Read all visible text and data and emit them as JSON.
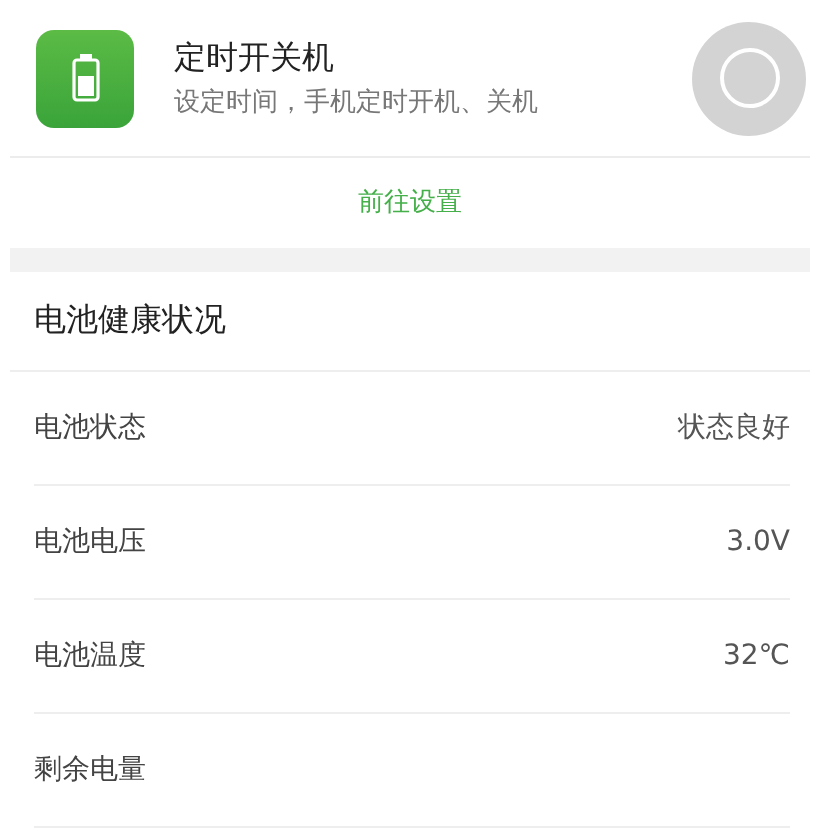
{
  "feature": {
    "title": "定时开关机",
    "subtitle": "设定时间，手机定时开机、关机",
    "toggle": {
      "on": false
    }
  },
  "link": "前往设置",
  "section": {
    "title": "电池健康状况",
    "rows": [
      {
        "label": "电池状态",
        "value": "状态良好"
      },
      {
        "label": "电池电压",
        "value": "3.0V"
      },
      {
        "label": "电池温度",
        "value": "32℃"
      },
      {
        "label": "剩余电量"
      }
    ]
  }
}
